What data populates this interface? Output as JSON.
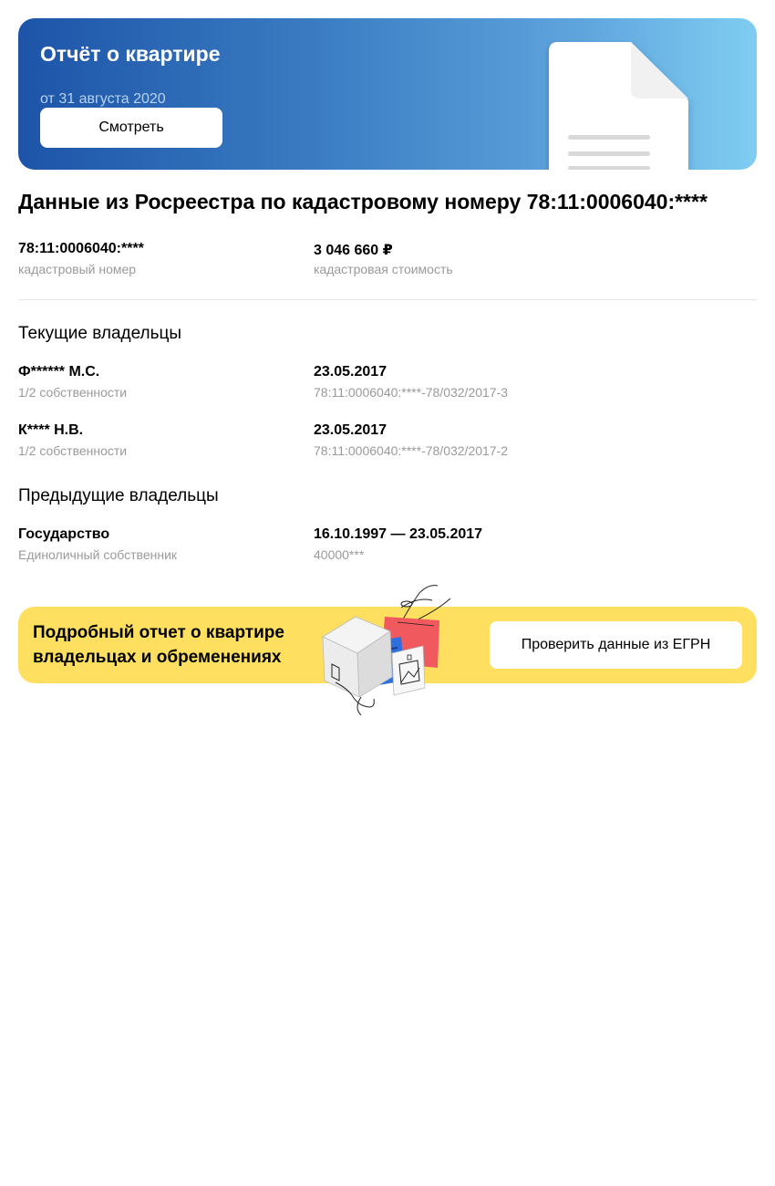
{
  "report": {
    "title": "Отчёт о квартире",
    "date": "от 31 августа 2020",
    "button_label": "Смотреть"
  },
  "cadastre": {
    "heading": "Данные из Росреестра по кадастровому номеру 78:11:0006040:****",
    "number_value": "78:11:0006040:****",
    "number_caption": "кадастровый номер",
    "cost_value": "3 046 660 ₽",
    "cost_caption": "кадастровая стоимость"
  },
  "current_owners": {
    "heading": "Текущие владельцы",
    "items": [
      {
        "name": "Ф****** М.С.",
        "share": "1/2 собственности",
        "date": "23.05.2017",
        "record": "78:11:0006040:****-78/032/2017-3"
      },
      {
        "name": "К**** Н.В.",
        "share": "1/2 собственности",
        "date": "23.05.2017",
        "record": "78:11:0006040:****-78/032/2017-2"
      }
    ]
  },
  "previous_owners": {
    "heading": "Предыдущие владельцы",
    "items": [
      {
        "name": "Государство",
        "share": "Единоличный собственник",
        "date": "16.10.1997 — 23.05.2017",
        "record": "40000***"
      }
    ]
  },
  "promo": {
    "text": "Подробный отчет о квартире владельцах и обременениях",
    "button_label": "Проверить данные из ЕГРН"
  },
  "colors": {
    "banner_gradient_start": "#1d54a8",
    "banner_gradient_end": "#7fcdf2",
    "promo_bg": "#fedf5f",
    "caption_gray": "#9a9a9a"
  },
  "icons": {
    "report": "document-icon",
    "promo": "house-box-illustration"
  }
}
